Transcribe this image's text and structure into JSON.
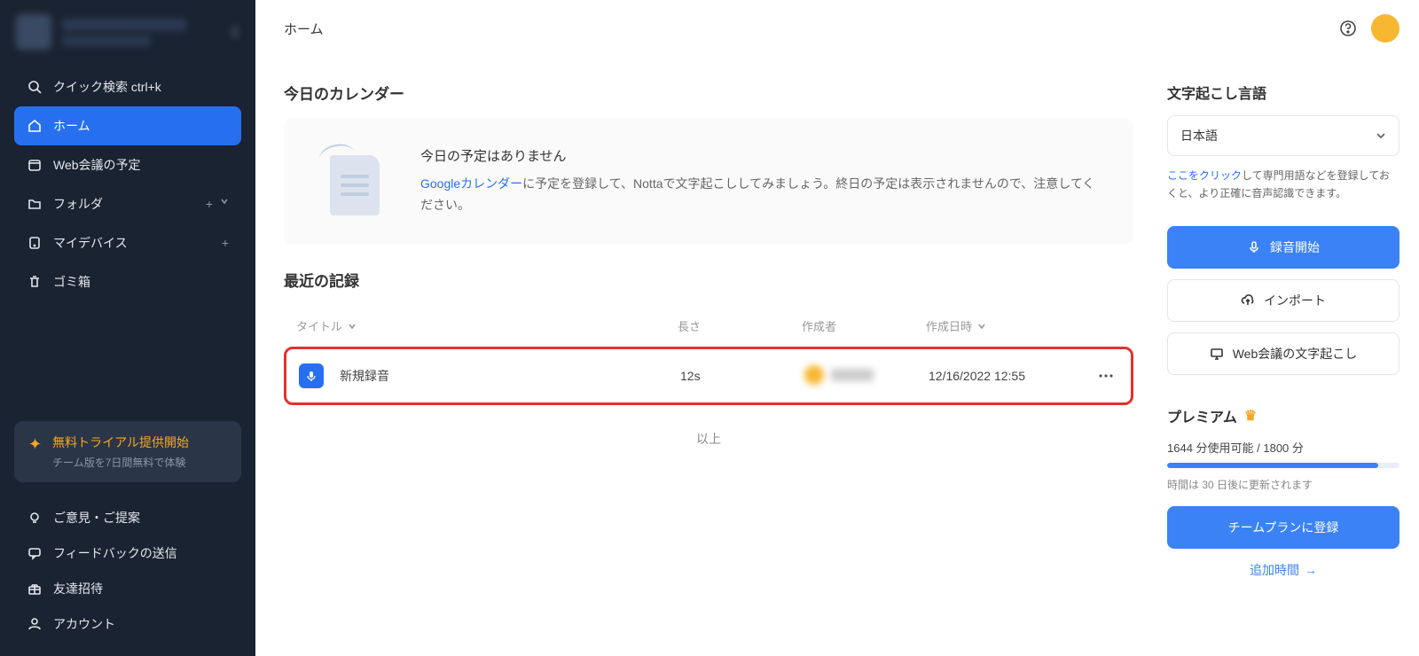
{
  "header": {
    "title": "ホーム"
  },
  "sidebar": {
    "quick_search": "クイック検索 ctrl+k",
    "items": [
      {
        "label": "ホーム"
      },
      {
        "label": "Web会議の予定"
      },
      {
        "label": "フォルダ"
      },
      {
        "label": "マイデバイス"
      },
      {
        "label": "ゴミ箱"
      }
    ],
    "trial": {
      "title": "無料トライアル提供開始",
      "sub": "チーム版を7日間無料で体験"
    },
    "bottom": [
      {
        "label": "ご意見・ご提案"
      },
      {
        "label": "フィードバックの送信"
      },
      {
        "label": "友達招待"
      },
      {
        "label": "アカウント"
      }
    ]
  },
  "calendar": {
    "section_title": "今日のカレンダー",
    "head": "今日の予定はありません",
    "link": "Googleカレンダー",
    "body_rest": "に予定を登録して、Nottaで文字起こししてみましょう。終日の予定は表示されませんので、注意してください。"
  },
  "records": {
    "section_title": "最近の記録",
    "columns": {
      "title": "タイトル",
      "length": "長さ",
      "author": "作成者",
      "date": "作成日時"
    },
    "rows": [
      {
        "title": "新規録音",
        "length": "12s",
        "date": "12/16/2022 12:55"
      }
    ],
    "end": "以上"
  },
  "right": {
    "lang_title": "文字起こし言語",
    "lang_value": "日本語",
    "hint_link": "ここをクリック",
    "hint_rest": "して専門用語などを登録しておくと、より正確に音声認識できます。",
    "actions": {
      "record": "録音開始",
      "import": "インポート",
      "web_transcribe": "Web会議の文字起こし"
    },
    "premium": {
      "title": "プレミアム",
      "usage": "1644 分使用可能 / 1800 分",
      "progress_pct": 91,
      "renew": "時間は 30 日後に更新されます",
      "team_btn": "チームプランに登録",
      "add_time": "追加時間"
    }
  }
}
